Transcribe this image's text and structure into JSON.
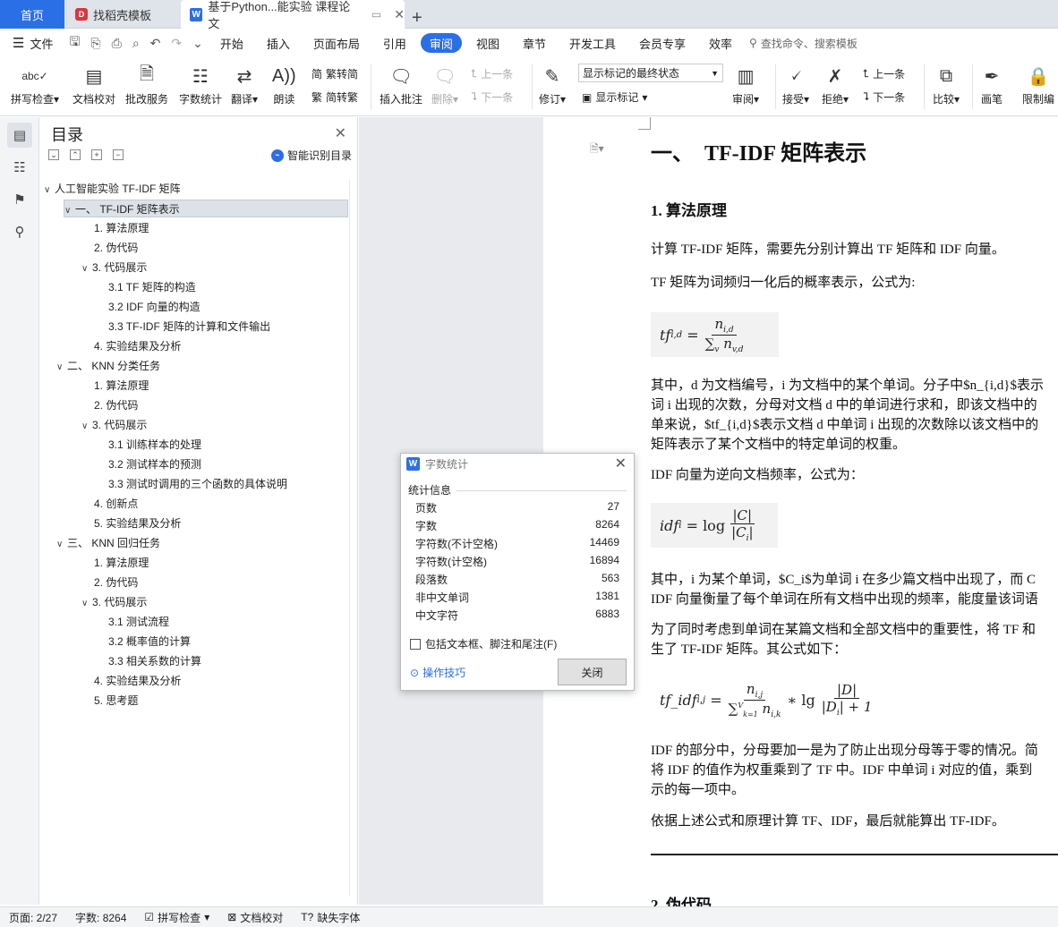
{
  "tabs": {
    "home": "首页",
    "template": "找稻壳模板",
    "document": "基于Python...能实验 课程论文"
  },
  "menu": {
    "file": "文件",
    "items": [
      "开始",
      "插入",
      "页面布局",
      "引用",
      "审阅",
      "视图",
      "章节",
      "开发工具",
      "会员专享",
      "效率"
    ],
    "active": "审阅",
    "search": "查找命令、搜索模板"
  },
  "ribbon": {
    "spellcheck": "拼写检查",
    "proofread": "文档校对",
    "batch": "批改服务",
    "wordcount": "字数统计",
    "translate": "翻译",
    "read": "朗读",
    "trad": "繁转简",
    "simp": "简转繁",
    "insert_comment": "插入批注",
    "delete": "删除",
    "prev": "上一条",
    "next": "下一条",
    "revise": "修订",
    "mark_select": "显示标记的最终状态",
    "show_mark": "显示标记",
    "review": "审阅",
    "accept": "接受",
    "reject": "拒绝",
    "prev2": "上一条",
    "next2": "下一条",
    "compare": "比较",
    "pen": "画笔",
    "restrict": "限制编"
  },
  "toc": {
    "title": "目录",
    "smart": "智能识别目录",
    "items": [
      {
        "text": "人工智能实验 TF-IDF 矩阵",
        "level": 0,
        "chevron": true
      },
      {
        "text": "一、  TF-IDF 矩阵表示",
        "level": 1,
        "chevron": true,
        "selected": true
      },
      {
        "text": "1. 算法原理",
        "level": 2
      },
      {
        "text": "2. 伪代码",
        "level": 2
      },
      {
        "text": "3. 代码展示",
        "level": 2,
        "chevron": true
      },
      {
        "text": "3.1 TF 矩阵的构造",
        "level": 3
      },
      {
        "text": "3.2 IDF 向量的构造",
        "level": 3
      },
      {
        "text": "3.3 TF-IDF 矩阵的计算和文件输出",
        "level": 3
      },
      {
        "text": "4. 实验结果及分析",
        "level": 2
      },
      {
        "text": "二、  KNN 分类任务",
        "level": 1,
        "chevron": true
      },
      {
        "text": "1. 算法原理",
        "level": 2
      },
      {
        "text": "2. 伪代码",
        "level": 2
      },
      {
        "text": "3. 代码展示",
        "level": 2,
        "chevron": true
      },
      {
        "text": "3.1  训练样本的处理",
        "level": 3
      },
      {
        "text": "3.2  测试样本的预测",
        "level": 3
      },
      {
        "text": "3.3  测试时调用的三个函数的具体说明",
        "level": 3
      },
      {
        "text": "4. 创新点",
        "level": 2
      },
      {
        "text": "5. 实验结果及分析",
        "level": 2
      },
      {
        "text": "三、  KNN 回归任务",
        "level": 1,
        "chevron": true
      },
      {
        "text": "1. 算法原理",
        "level": 2
      },
      {
        "text": "2. 伪代码",
        "level": 2
      },
      {
        "text": "3. 代码展示",
        "level": 2,
        "chevron": true
      },
      {
        "text": "3.1  测试流程",
        "level": 3
      },
      {
        "text": "3.2  概率值的计算",
        "level": 3
      },
      {
        "text": "3.3  相关系数的计算",
        "level": 3
      },
      {
        "text": "4. 实验结果及分析",
        "level": 2
      },
      {
        "text": "5. 思考题",
        "level": 2
      }
    ]
  },
  "dialog": {
    "title": "字数统计",
    "section": "统计信息",
    "stats": [
      {
        "label": "页数",
        "value": "27"
      },
      {
        "label": "字数",
        "value": "8264"
      },
      {
        "label": "字符数(不计空格)",
        "value": "14469"
      },
      {
        "label": "字符数(计空格)",
        "value": "16894"
      },
      {
        "label": "段落数",
        "value": "563"
      },
      {
        "label": "非中文单词",
        "value": "1381"
      },
      {
        "label": "中文字符",
        "value": "6883"
      }
    ],
    "checkbox": "包括文本框、脚注和尾注(F)",
    "tips": "操作技巧",
    "close": "关闭"
  },
  "doc": {
    "h1_num": "一、",
    "h1_text": "TF-IDF 矩阵表示",
    "h2": "1.  算法原理",
    "p1": "计算 TF-IDF 矩阵，需要先分别计算出 TF 矩阵和 IDF 向量。",
    "p2": "TF 矩阵为词频归一化后的概率表示，公式为:",
    "p3a": "其中，d 为文档编号，i 为文档中的某个单词。分子中$n_{i,d}$表示",
    "p3b": "词 i 出现的次数，分母对文档 d 中的单词进行求和，即该文档中的",
    "p3c": "单来说，$tf_{i,d}$表示文档 d 中单词 i 出现的次数除以该文档中的",
    "p3d": "矩阵表示了某个文档中的特定单词的权重。",
    "p4": "IDF 向量为逆向文档频率，公式为：",
    "p5a": "其中，i 为某个单词，$C_i$为单词 i 在多少篇文档中出现了，而 C",
    "p5b": "IDF 向量衡量了每个单词在所有文档中出现的频率，能度量该词语",
    "p6a": "为了同时考虑到单词在某篇文档和全部文档中的重要性，将 TF 和",
    "p6b": "生了 TF-IDF 矩阵。其公式如下：",
    "p7a": "IDF 的部分中，分母要加一是为了防止出现分母等于零的情况。简",
    "p7b": "将 IDF 的值作为权重乘到了 TF 中。IDF 中单词 i 对应的值，乘到",
    "p7c": "示的每一项中。",
    "p8": "依据上述公式和原理计算 TF、IDF，最后就能算出 TF-IDF。",
    "h2b": "2.  伪代码"
  },
  "status": {
    "page": "页面: 2/27",
    "words": "字数: 8264",
    "spell": "拼写检查",
    "proof": "文档校对",
    "font": "缺失字体"
  },
  "colors": {
    "accent": "#2b6fe6"
  }
}
